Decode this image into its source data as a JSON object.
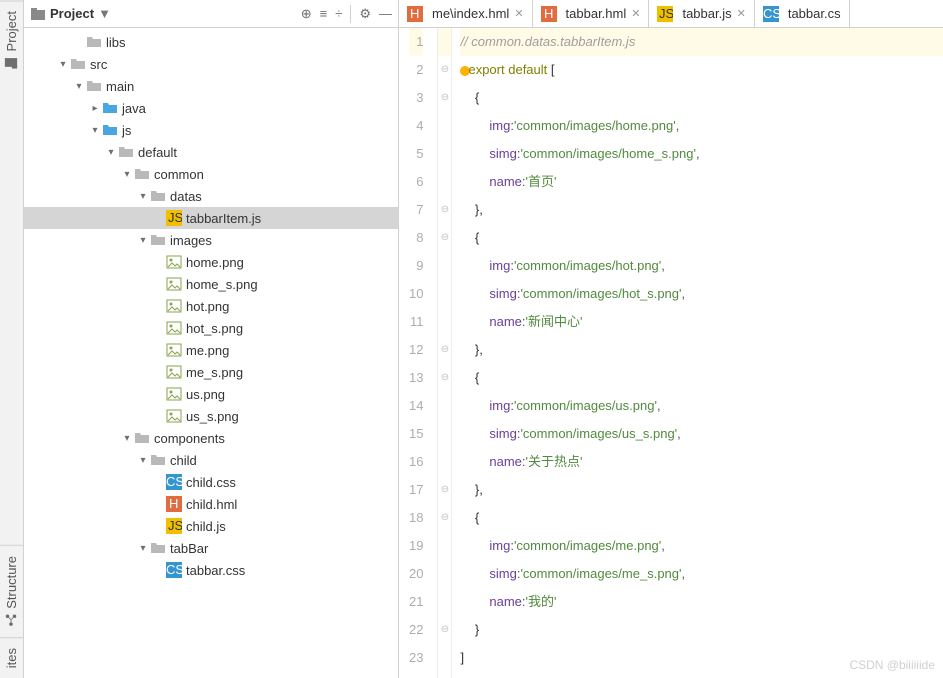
{
  "leftbars": {
    "project": "Project",
    "structure": "Structure",
    "favorites": "ites"
  },
  "panel": {
    "title": "Project",
    "toolbar": {
      "target": "⊕",
      "expand": "≡",
      "collapse": "÷",
      "settings": "⚙",
      "hide": "—"
    }
  },
  "tree": [
    {
      "depth": 3,
      "arrow": "",
      "icon": "folder",
      "label": "libs"
    },
    {
      "depth": 2,
      "arrow": "▾",
      "icon": "folder",
      "label": "src"
    },
    {
      "depth": 3,
      "arrow": "▾",
      "icon": "folder",
      "label": "main"
    },
    {
      "depth": 4,
      "arrow": "▸",
      "icon": "folder-blue",
      "label": "java"
    },
    {
      "depth": 4,
      "arrow": "▾",
      "icon": "folder-blue",
      "label": "js"
    },
    {
      "depth": 5,
      "arrow": "▾",
      "icon": "folder",
      "label": "default"
    },
    {
      "depth": 6,
      "arrow": "▾",
      "icon": "folder",
      "label": "common"
    },
    {
      "depth": 7,
      "arrow": "▾",
      "icon": "folder",
      "label": "datas"
    },
    {
      "depth": 8,
      "arrow": "",
      "icon": "js",
      "label": "tabbarItem.js",
      "selected": true
    },
    {
      "depth": 7,
      "arrow": "▾",
      "icon": "folder",
      "label": "images"
    },
    {
      "depth": 8,
      "arrow": "",
      "icon": "img",
      "label": "home.png"
    },
    {
      "depth": 8,
      "arrow": "",
      "icon": "img",
      "label": "home_s.png"
    },
    {
      "depth": 8,
      "arrow": "",
      "icon": "img",
      "label": "hot.png"
    },
    {
      "depth": 8,
      "arrow": "",
      "icon": "img",
      "label": "hot_s.png"
    },
    {
      "depth": 8,
      "arrow": "",
      "icon": "img",
      "label": "me.png"
    },
    {
      "depth": 8,
      "arrow": "",
      "icon": "img",
      "label": "me_s.png"
    },
    {
      "depth": 8,
      "arrow": "",
      "icon": "img",
      "label": "us.png"
    },
    {
      "depth": 8,
      "arrow": "",
      "icon": "img",
      "label": "us_s.png"
    },
    {
      "depth": 6,
      "arrow": "▾",
      "icon": "folder",
      "label": "components"
    },
    {
      "depth": 7,
      "arrow": "▾",
      "icon": "folder",
      "label": "child"
    },
    {
      "depth": 8,
      "arrow": "",
      "icon": "css",
      "label": "child.css"
    },
    {
      "depth": 8,
      "arrow": "",
      "icon": "hml",
      "label": "child.hml"
    },
    {
      "depth": 8,
      "arrow": "",
      "icon": "js",
      "label": "child.js"
    },
    {
      "depth": 7,
      "arrow": "▾",
      "icon": "folder",
      "label": "tabBar"
    },
    {
      "depth": 8,
      "arrow": "",
      "icon": "css",
      "label": "tabbar.css"
    }
  ],
  "tabs": [
    {
      "icon": "hml",
      "label": "me\\index.hml",
      "active": false
    },
    {
      "icon": "hml",
      "label": "tabbar.hml",
      "active": false
    },
    {
      "icon": "js",
      "label": "tabbar.js",
      "active": false
    },
    {
      "icon": "css",
      "label": "tabbar.cs",
      "active": false,
      "noclose": true
    }
  ],
  "code": {
    "lines": 23,
    "comment": "// common.datas.tabbarItem.js",
    "kw_export": "export",
    "kw_default": "default",
    "open_arr": "[",
    "open_brace": "{",
    "close_brace_c": "},",
    "close_brace": "}",
    "close_arr": "]",
    "prop_img": "img",
    "prop_simg": "simg",
    "prop_name": "name",
    "items": [
      {
        "img": "'common/images/home.png'",
        "simg": "'common/images/home_s.png'",
        "name": "'首页'"
      },
      {
        "img": "'common/images/hot.png'",
        "simg": "'common/images/hot_s.png'",
        "name": "'新闻中心'"
      },
      {
        "img": "'common/images/us.png'",
        "simg": "'common/images/us_s.png'",
        "name": "'关于热点'"
      },
      {
        "img": "'common/images/me.png'",
        "simg": "'common/images/me_s.png'",
        "name": "'我的'"
      }
    ]
  },
  "watermark": "CSDN @biiiiiide"
}
